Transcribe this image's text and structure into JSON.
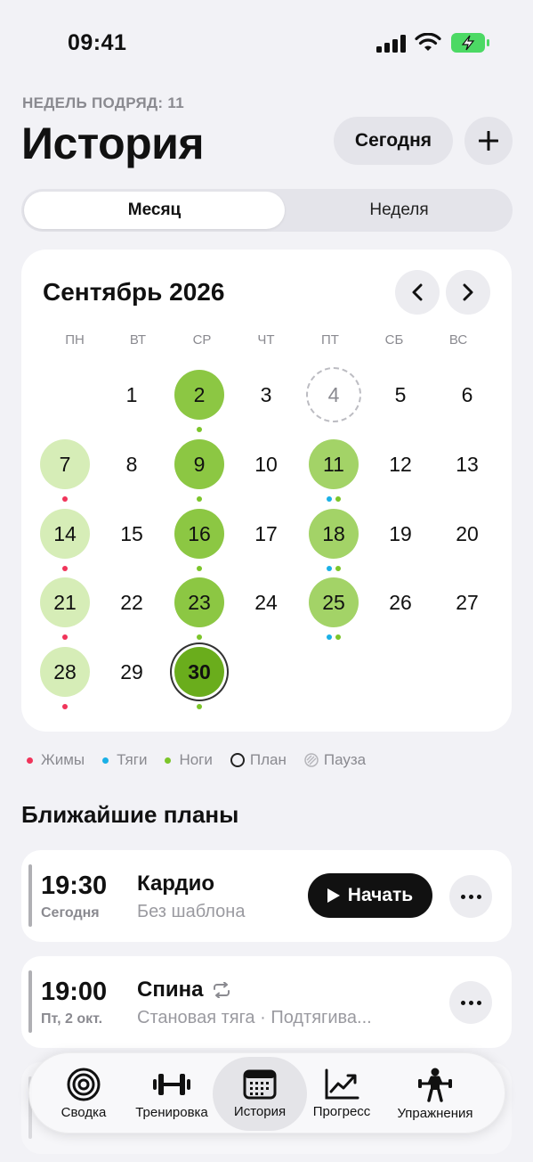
{
  "status": {
    "time": "09:41"
  },
  "header": {
    "streak": "НЕДЕЛЬ ПОДРЯД: 11",
    "title": "История",
    "today_button": "Сегодня"
  },
  "segmented": {
    "month": "Месяц",
    "week": "Неделя"
  },
  "calendar": {
    "month_title": "Сентябрь 2026",
    "weekdays": [
      "ПН",
      "ВТ",
      "СР",
      "ЧТ",
      "ПТ",
      "СБ",
      "ВС"
    ],
    "days": [
      "1",
      "2",
      "3",
      "4",
      "5",
      "6",
      "7",
      "8",
      "9",
      "10",
      "11",
      "12",
      "13",
      "14",
      "15",
      "16",
      "17",
      "18",
      "19",
      "20",
      "21",
      "22",
      "23",
      "24",
      "25",
      "26",
      "27",
      "28",
      "29",
      "30"
    ]
  },
  "legend": {
    "push": "Жимы",
    "pull": "Тяги",
    "legs": "Ноги",
    "plan": "План",
    "pause": "Пауза"
  },
  "colors": {
    "push": "#f0345a",
    "pull": "#1ab0e6",
    "legs": "#7cc52a"
  },
  "plans_title": "Ближайшие планы",
  "plans": [
    {
      "time": "19:30",
      "day": "Сегодня",
      "name": "Кардио",
      "subtitle": "Без шаблона",
      "start": "Начать"
    },
    {
      "time": "19:00",
      "day": "Пт, 2 окт.",
      "name": "Спина",
      "subtitle": "Становая тяга · Подтягива..."
    }
  ],
  "tabs": {
    "summary": "Сводка",
    "workout": "Тренировка",
    "history": "История",
    "progress": "Прогресс",
    "exercises": "Упражнения"
  }
}
